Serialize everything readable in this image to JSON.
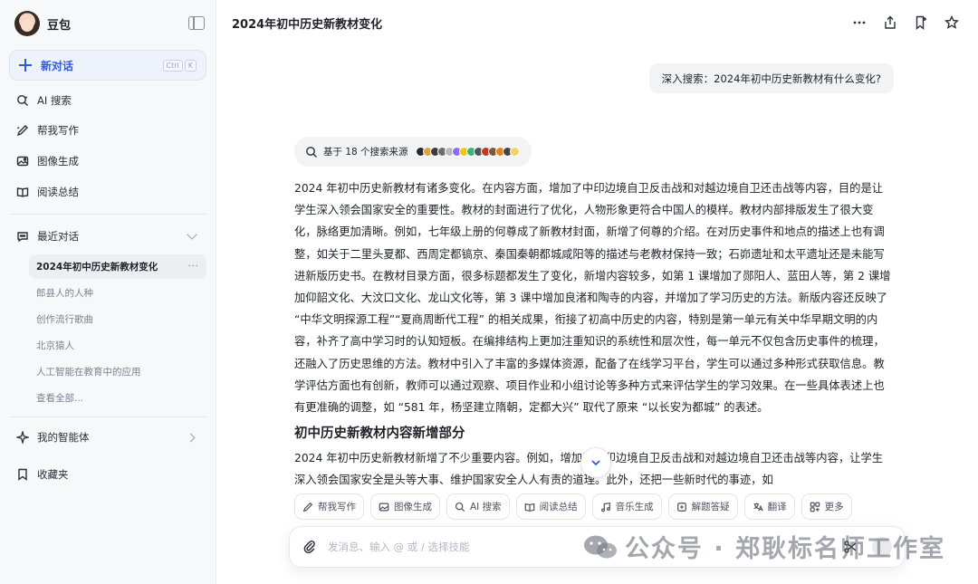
{
  "sidebar": {
    "brand": "豆包",
    "new_chat": "新对话",
    "shortcut": [
      "Ctrl",
      "K"
    ],
    "tools": [
      {
        "label": "AI 搜索",
        "icon": "ai-search-icon"
      },
      {
        "label": "帮我写作",
        "icon": "writing-icon"
      },
      {
        "label": "图像生成",
        "icon": "image-icon"
      },
      {
        "label": "阅读总结",
        "icon": "reading-icon"
      }
    ],
    "recent_header": "最近对话",
    "recent": [
      "2024年初中历史新教材变化",
      "郎县人的人种",
      "创作流行歌曲",
      "北京猿人",
      "人工智能在教育中的应用",
      "查看全部..."
    ],
    "agents": "我的智能体",
    "favorites": "收藏夹"
  },
  "conversation": {
    "title": "2024年初中历史新教材变化",
    "user_query": "深入搜索：2024年初中历史新教材有什么变化?",
    "sources_label": "基于 18 个搜索来源",
    "answer_paragraph": "2024 年初中历史新教材有诸多变化。在内容方面，增加了中印边境自卫反击战和对越边境自卫还击战等内容，目的是让学生深入领会国家安全的重要性。教材的封面进行了优化，人物形象更符合中国人的模样。教材内部排版发生了很大变化，脉络更加清晰。例如，七年级上册的何尊成了新教材封面，新增了何尊的介绍。在对历史事件和地点的描述上也有调整，如关于二里头夏都、西周定都镐京、秦国秦朝都城咸阳等的描述与老教材保持一致；石峁遗址和太平遗址还是未能写进新版历史书。在教材目录方面，很多标题都发生了变化，新增内容较多，如第 1 课增加了郧阳人、蓝田人等，第 2 课增加仰韶文化、大汶口文化、龙山文化等，第 3 课中增加良渚和陶寺的内容，并增加了学习历史的方法。新版内容还反映了 “中华文明探源工程”“夏商周断代工程” 的相关成果，衔接了初高中历史的内容，特别是第一单元有关中华早期文明的内容，补齐了高中学习时的认知短板。在编排结构上更加注重知识的系统性和层次性，每一单元不仅包含历史事件的梳理，还融入了历史思维的方法。教材中引入了丰富的多媒体资源，配备了在线学习平台，学生可以通过多种形式获取信息。教学评估方面也有创新，教师可以通过观察、项目作业和小组讨论等多种方式来评估学生的学习效果。在一些具体表述上也有更准确的调整，如 “581 年，杨坚建立隋朝，定都大兴” 取代了原来 “以长安为都城” 的表述。",
    "section_heading": "初中历史新教材内容新增部分",
    "section_paragraph": "2024 年初中历史新教材新增了不少重要内容。例如，增加了中印边境自卫反击战和对越边境自卫还击战等内容，让学生深入领会国家安全是头等大事、维护国家安全人人有责的道理。此外，还把一些新时代的事迹，如"
  },
  "quick_actions": [
    "帮我写作",
    "图像生成",
    "AI 搜索",
    "阅读总结",
    "音乐生成",
    "解题答疑",
    "翻译",
    "更多"
  ],
  "composer": {
    "placeholder": "发消息、输入 @ 或 / 选择技能"
  },
  "watermark": "公众号 · 郑耿标名师工作室",
  "colors": {
    "accent": "#2f5bd8",
    "sidebar_bg": "#f7f8fa",
    "bubble_bg": "#f2f3f5"
  }
}
